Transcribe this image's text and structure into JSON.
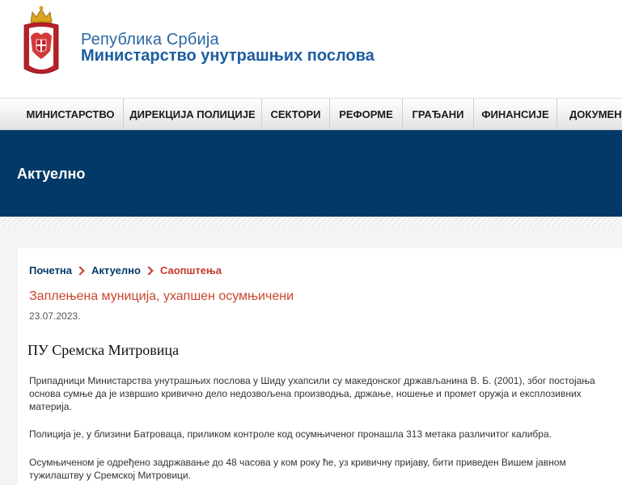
{
  "header": {
    "gov_name": "Република Србија",
    "ministry_name": "Министарство унутрашњих послова"
  },
  "nav": {
    "items": [
      "МИНИСТАРСТВО",
      "ДИРЕКЦИЈА ПОЛИЦИЈЕ",
      "СЕКТОРИ",
      "РЕФОРМЕ",
      "ГРАЂАНИ",
      "ФИНАНСИЈЕ",
      "ДОКУМЕНТ"
    ]
  },
  "banner": {
    "title": "Актуелно"
  },
  "breadcrumb": {
    "items": [
      "Почетна",
      "Актуелно",
      "Саопштења"
    ]
  },
  "article": {
    "title": "Заплењена муниција, ухапшен осумњичени",
    "date": "23.07.2023.",
    "subtitle": "ПУ Сремска Митровица",
    "paragraphs": [
      "Припадници Министарства унутрашњих послова у Шиду ухапсили су македонског држављанина В. Б. (2001), због постојања основа сумње да је извршио кривично дело недозвољена производња, држање, ношење и промет оружја и експлозивних материја.",
      "Полиција је, у близини Батроваца, приликом контроле код осумњиченог пронашла 313 метака различитог калибра.",
      "Осумњиченом је одређено задржавање до 48 часова у ком року ће, уз кривичну пријаву, бити приведен Вишем јавном тужилаштву у Сремској Митровици."
    ]
  },
  "colors": {
    "banner_bg": "#033966",
    "title_red": "#c8462e",
    "link_blue": "#033966"
  },
  "icons": {
    "logo": "coat-of-arms-icon",
    "breadcrumb_separator": "chevron-right-icon"
  }
}
